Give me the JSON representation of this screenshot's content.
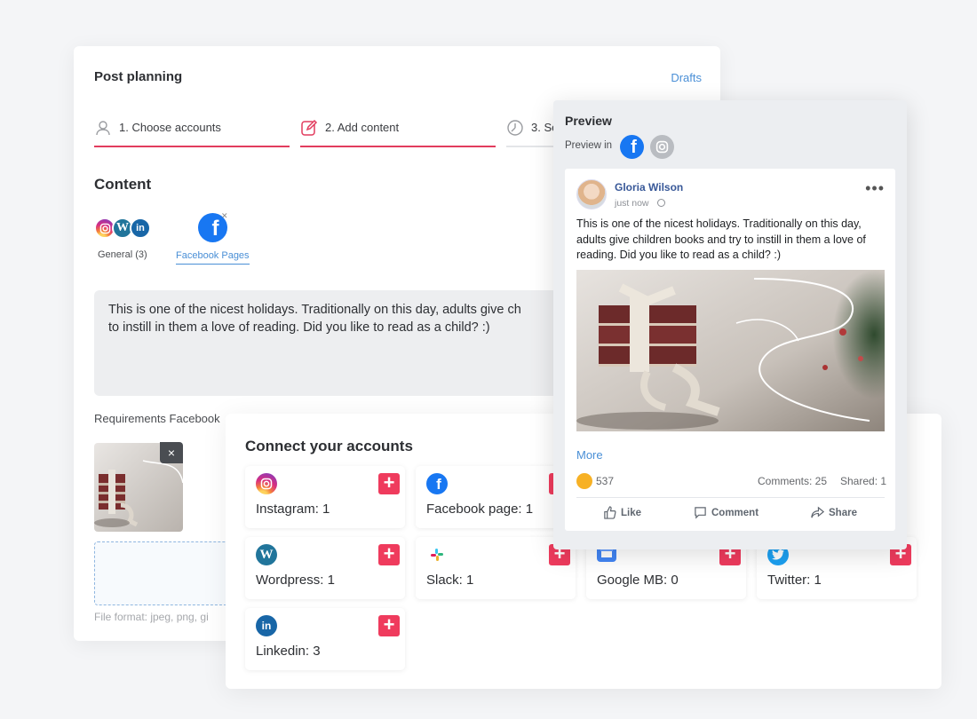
{
  "planning": {
    "title": "Post planning",
    "drafts_label": "Drafts",
    "steps": [
      {
        "label": "1. Choose accounts"
      },
      {
        "label": "2. Add content"
      },
      {
        "label": "3. Se"
      }
    ],
    "content_heading": "Content",
    "groups": {
      "general_label": "General (3)",
      "facebook_label": "Facebook Pages"
    },
    "post_text": "This is one of the nicest holidays. Traditionally on this day, adults give ch\nto instill in them a love of reading. Did you like to read as a child? :)",
    "requirements_label": "Requirements Facebook",
    "remove_image_label": "×",
    "file_format_label": "File format: jpeg, png, gi"
  },
  "connect": {
    "heading": "Connect your accounts",
    "tiles": [
      {
        "name": "Instagram: 1",
        "icon": "instagram-icon"
      },
      {
        "name": "Facebook page: 1",
        "icon": "facebook-icon"
      },
      {
        "name": "Wordpress: 1",
        "icon": "wordpress-icon"
      },
      {
        "name": "Slack: 1",
        "icon": "slack-icon"
      },
      {
        "name": "Google MB: 0",
        "icon": "google-mb-icon"
      },
      {
        "name": "Twitter: 1",
        "icon": "twitter-icon"
      },
      {
        "name": "Linkedin: 3",
        "icon": "linkedin-icon"
      }
    ],
    "add_label": "+"
  },
  "preview": {
    "heading": "Preview",
    "preview_in_label": "Preview in",
    "post": {
      "author": "Gloria Wilson",
      "time": "just now",
      "more_menu": "•••",
      "text": "This is one of the nicest holidays. Traditionally on this day, adults give children books and try to instill in them a love of reading. Did you like to read as a child? :)",
      "more_label": "More",
      "reactions_count": "537",
      "comments_label": "Comments: 25",
      "shared_label": "Shared: 1",
      "actions": {
        "like": "Like",
        "comment": "Comment",
        "share": "Share"
      }
    }
  },
  "colors": {
    "accent_red": "#ef3b5d",
    "link_blue": "#4a8fd6",
    "facebook_blue": "#1877f2"
  }
}
